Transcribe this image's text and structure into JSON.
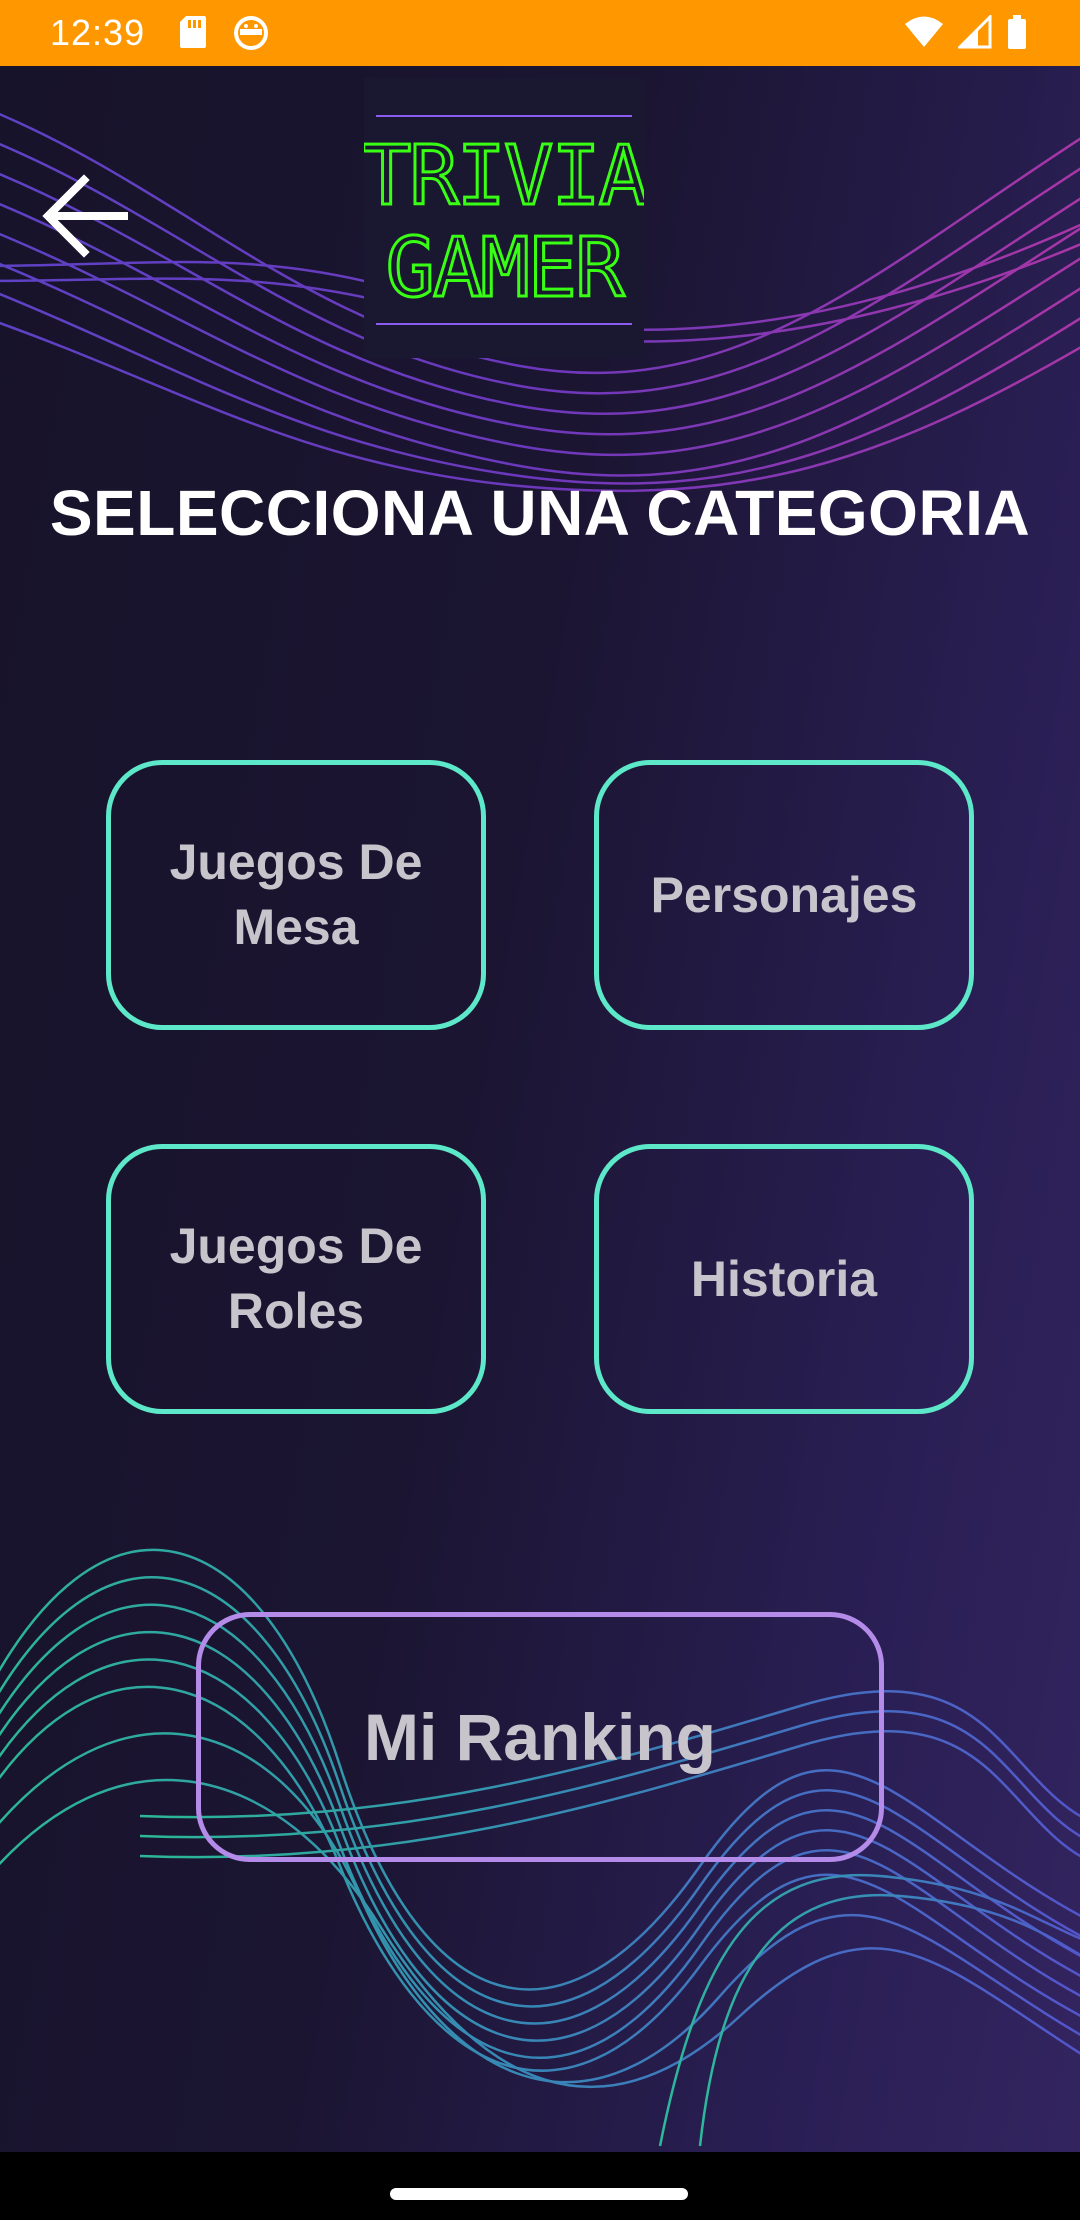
{
  "status_bar": {
    "time": "12:39",
    "color": "#ff9800",
    "icons_left": [
      "sd-card-icon",
      "android-debug-icon"
    ],
    "icons_right": [
      "wifi-icon",
      "signal-icon",
      "battery-icon"
    ]
  },
  "header": {
    "back_icon": "arrow-left-icon",
    "logo_line1": "TRIVIA",
    "logo_line2": "GAMER"
  },
  "main": {
    "title": "SELECCIONA UNA CATEGORIA",
    "categories": [
      {
        "line1": "Juegos De",
        "line2": "Mesa"
      },
      {
        "line1": "Personajes",
        "line2": ""
      },
      {
        "line1": "Juegos De",
        "line2": "Roles"
      },
      {
        "line1": "Historia",
        "line2": ""
      }
    ],
    "ranking_label": "Mi Ranking"
  },
  "colors": {
    "background_start": "#17132a",
    "background_end": "#33245f",
    "category_border": "#5ce8c9",
    "ranking_border": "#b48be8",
    "button_text": "#c7c4cc",
    "logo_neon": "#39ff14",
    "logo_lines": "#8a5cf0"
  }
}
